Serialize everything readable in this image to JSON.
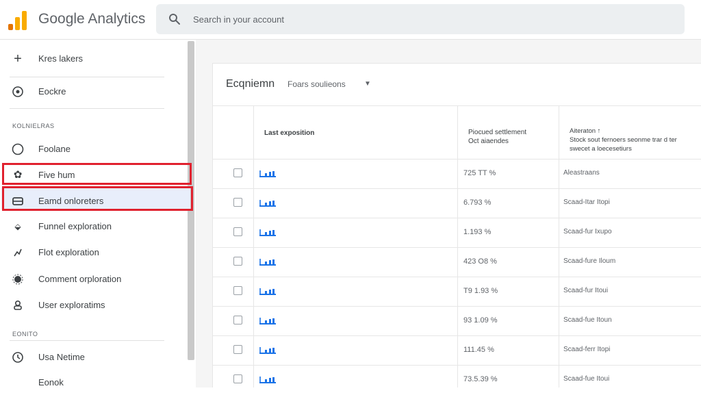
{
  "header": {
    "app_title": "Google Analytics",
    "search_placeholder": "Search in your account",
    "brand_colors": {
      "bar_orange": "#f9ab00",
      "bar_dark_orange": "#e37400"
    }
  },
  "sidebar": {
    "top_items": [
      {
        "label": "Kres lakers",
        "icon": "plus-icon"
      },
      {
        "label": "Eockre",
        "icon": "refresh-icon"
      }
    ],
    "section_1_label": "Kolnielras",
    "items": [
      {
        "label": "Foolane",
        "icon": "circle-icon"
      },
      {
        "label": "Five hum",
        "icon": "gear-icon"
      },
      {
        "label": "Eamd onloreters",
        "icon": "table-icon"
      },
      {
        "label": "Funnel exploration",
        "icon": "funnel-icon"
      },
      {
        "label": "Flot exploration",
        "icon": "path-icon"
      },
      {
        "label": "Comment orploration",
        "icon": "segment-icon"
      },
      {
        "label": "User exploratims",
        "icon": "user-icon"
      }
    ],
    "section_2_label": "Eonito",
    "bottom_items": [
      {
        "label": "Usa Netime",
        "icon": "clock-icon"
      },
      {
        "label": "Eonok",
        "icon": "none"
      }
    ],
    "highlight_color": "#e0212e"
  },
  "main": {
    "title": "Ecqniemn",
    "dropdown_label": "Foars soulieons",
    "columns": [
      "Last exposition",
      "Piocued settlement\nOct aiaendes",
      "Aiteraton ↑\nStock sout fernoers seonme trar d ter\nswecet a loecesetiurs"
    ],
    "rows": [
      {
        "value": "725 TT %",
        "type": "Aleastraans"
      },
      {
        "value": "6.793 %",
        "type": "Scaad-Itar Itopi"
      },
      {
        "value": "1.193 %",
        "type": "Scaad-fur Ixupo"
      },
      {
        "value": "423 O8 %",
        "type": "Scaad-fure Iloum"
      },
      {
        "value": "T9 1.93 %",
        "type": "Scaad-fur Itoui"
      },
      {
        "value": "93 1.09 %",
        "type": "Scaad-fue Itoun"
      },
      {
        "value": "111.45 %",
        "type": "Scaad-ferr Itopi"
      },
      {
        "value": "73.5.39 %",
        "type": "Scaad-fue Itoui"
      }
    ],
    "spark_color": "#1a73e8"
  }
}
